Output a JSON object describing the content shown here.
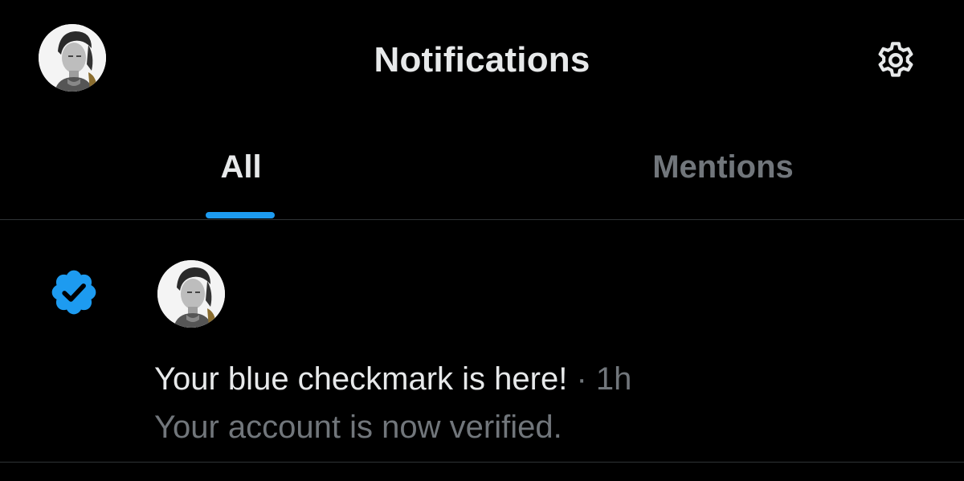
{
  "header": {
    "title": "Notifications",
    "avatar_icon": "profile-avatar",
    "settings_icon": "gear-icon"
  },
  "tabs": [
    {
      "label": "All",
      "active": true
    },
    {
      "label": "Mentions",
      "active": false
    }
  ],
  "notification": {
    "icon": "verified-badge-icon",
    "title": "Your blue checkmark is here!",
    "separator": "·",
    "time": "1h",
    "subtitle": "Your account is now verified."
  },
  "colors": {
    "background": "#000000",
    "text_primary": "#e7e9ea",
    "text_secondary": "#71767b",
    "accent": "#1d9bf0",
    "divider": "#2f3336"
  }
}
